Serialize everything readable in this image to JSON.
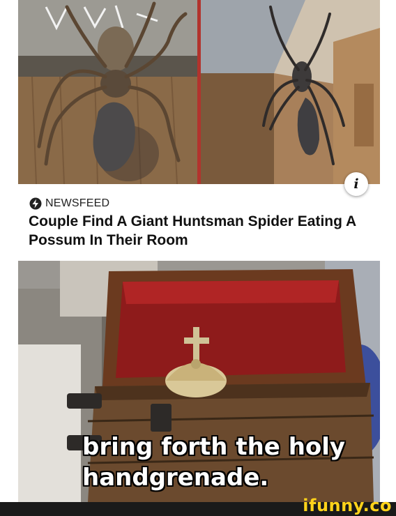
{
  "article": {
    "source_icon": "lightning-bolt-icon",
    "source": "NEWSFEED",
    "headline": "Couple Find A Giant Huntsman Spider Eating A Possum In Their Room",
    "info_button": "i",
    "images": [
      "huntsman-spider-eating-possum-photo-left",
      "huntsman-spider-eating-possum-photo-right"
    ]
  },
  "meme": {
    "image": "holy-handgrenade-scene",
    "caption_line1": "bring forth the holy",
    "caption_line2": "handgrenade."
  },
  "footer": {
    "watermark": "ifunny.co",
    "watermark_color": "#ffd21a"
  },
  "colors": {
    "divider": "#b2332d",
    "text": "#111111"
  }
}
